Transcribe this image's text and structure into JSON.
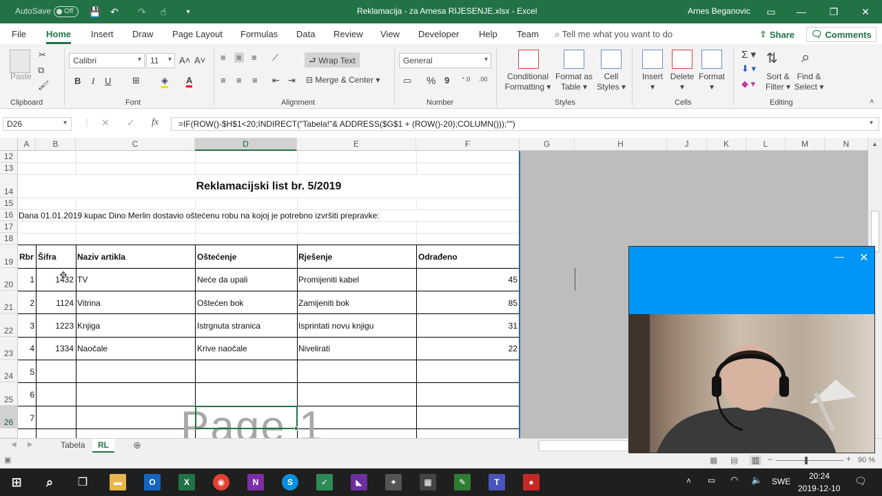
{
  "titlebar": {
    "autosave_label": "AutoSave",
    "autosave_state": "Off",
    "doc_title": "Reklamacija - za Arnesa RIJESENJE.xlsx  -  Excel",
    "user": "Arnes Beganovic"
  },
  "tabs": [
    "File",
    "Home",
    "Insert",
    "Draw",
    "Page Layout",
    "Formulas",
    "Data",
    "Review",
    "View",
    "Developer",
    "Help",
    "Team"
  ],
  "active_tab": "Home",
  "tell_me": "Tell me what you want to do",
  "share_label": "Share",
  "comments_label": "Comments",
  "ribbon": {
    "paste": "Paste",
    "font_name": "Calibri",
    "font_size": "11",
    "wrap_text": "Wrap Text",
    "merge_center": "Merge & Center",
    "number_format": "General",
    "conditional": [
      "Conditional",
      "Formatting"
    ],
    "format_table": [
      "Format as",
      "Table"
    ],
    "cell_styles": [
      "Cell",
      "Styles"
    ],
    "insert": "Insert",
    "delete": "Delete",
    "format": "Format",
    "sort_filter": [
      "Sort &",
      "Filter"
    ],
    "find_select": [
      "Find &",
      "Select"
    ],
    "groups": [
      "Clipboard",
      "Font",
      "Alignment",
      "Number",
      "Styles",
      "Cells",
      "Editing"
    ]
  },
  "name_box": "D26",
  "formula": "=IF(ROW()-$H$1<20;INDIRECT(\"Tabela!\"& ADDRESS($G$1 + (ROW()-20);COLUMN()));\"\")",
  "columns": [
    "A",
    "B",
    "C",
    "D",
    "E",
    "F",
    "G",
    "H",
    "J",
    "K",
    "L",
    "M",
    "N"
  ],
  "rows": [
    "12",
    "13",
    "14",
    "15",
    "16",
    "17",
    "18",
    "19",
    "20",
    "21",
    "22",
    "23",
    "24",
    "25",
    "26"
  ],
  "sheet": {
    "title": "Reklamacijski list br. 5/2019",
    "intro": "Dana 01.01.2019 kupac Dino Merlin dostavio oštećenu robu na kojoj je potrebno izvršiti prepravke:",
    "headers": [
      "Rbr",
      "Šifra",
      "Naziv artikla",
      "Oštećenje",
      "Rješenje",
      "Odrađeno"
    ],
    "items": [
      {
        "rbr": "1",
        "sifra": "1432",
        "naziv": "TV",
        "ostecenje": "Neće da upali",
        "rjesenje": "Promijeniti kabel",
        "odradjeno": "45"
      },
      {
        "rbr": "2",
        "sifra": "1124",
        "naziv": "Vitrina",
        "ostecenje": "Oštećen bok",
        "rjesenje": "Zamijeniti bok",
        "odradjeno": "85"
      },
      {
        "rbr": "3",
        "sifra": "1223",
        "naziv": "Knjiga",
        "ostecenje": "Istrgnuta stranica",
        "rjesenje": "Isprintati novu knjigu",
        "odradjeno": "31"
      },
      {
        "rbr": "4",
        "sifra": "1334",
        "naziv": "Naočale",
        "ostecenje": "Krive naočale",
        "rjesenje": "Nivelirati",
        "odradjeno": "22"
      }
    ],
    "empty_rbr": [
      "5",
      "6",
      "7"
    ],
    "watermark": "Page 1"
  },
  "sheet_tabs": [
    "Tabela",
    "RL"
  ],
  "active_sheet": "RL",
  "zoom": "90 %",
  "taskbar": {
    "lang": "SWE",
    "time": "20:24",
    "date": "2019-12-10"
  }
}
